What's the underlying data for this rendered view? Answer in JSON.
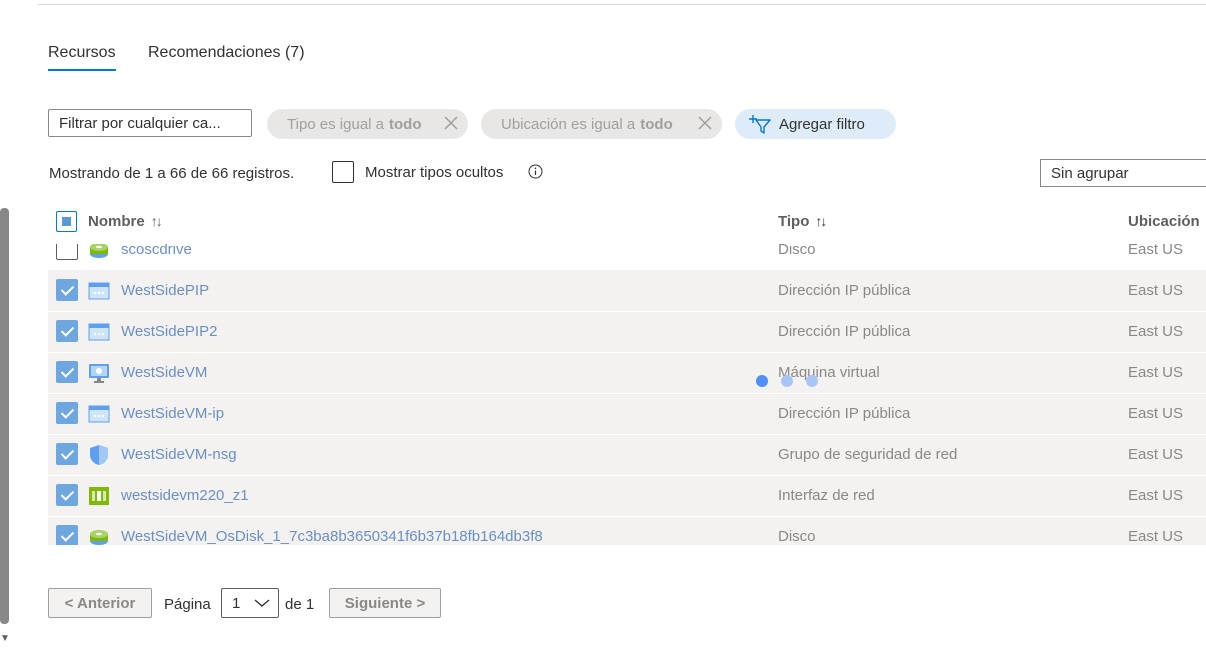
{
  "tabs": [
    {
      "label": "Recursos",
      "active": true
    },
    {
      "label": "Recomendaciones (7)",
      "active": false
    }
  ],
  "filters": {
    "search_placeholder": "Filtrar por cualquier ca...",
    "type_pill_prefix": "Tipo es igual a",
    "type_pill_value": "todo",
    "location_pill_prefix": "Ubicación es igual a",
    "location_pill_value": "todo",
    "add_filter_label": "Agregar filtro"
  },
  "summary": {
    "showing_text": "Mostrando de 1 a 66 de 66 registros.",
    "show_hidden_label": "Mostrar tipos ocultos",
    "group_by_value": "Sin agrupar"
  },
  "table": {
    "columns": [
      {
        "label": "Nombre",
        "sort": "↑↓"
      },
      {
        "label": "Tipo",
        "sort": "↑↓"
      },
      {
        "label": "Ubicación"
      }
    ],
    "rows": [
      {
        "name": "scoscdrive",
        "type": "Disco",
        "location": "East US",
        "selected": false,
        "icon": "disk-icon"
      },
      {
        "name": "WestSidePIP",
        "type": "Dirección IP pública",
        "location": "East US",
        "selected": true,
        "icon": "public-ip-icon"
      },
      {
        "name": "WestSidePIP2",
        "type": "Dirección IP pública",
        "location": "East US",
        "selected": true,
        "icon": "public-ip-icon"
      },
      {
        "name": "WestSideVM",
        "type": "Máquina virtual",
        "location": "East US",
        "selected": true,
        "icon": "virtual-machine-icon"
      },
      {
        "name": "WestSideVM-ip",
        "type": "Dirección IP pública",
        "location": "East US",
        "selected": true,
        "icon": "public-ip-icon"
      },
      {
        "name": "WestSideVM-nsg",
        "type": "Grupo de seguridad de red",
        "location": "East US",
        "selected": true,
        "icon": "network-security-group-icon"
      },
      {
        "name": "westsidevm220_z1",
        "type": "Interfaz de red",
        "location": "East US",
        "selected": true,
        "icon": "network-interface-icon"
      },
      {
        "name": "WestSideVM_OsDisk_1_7c3ba8b3650341f6b37b18fb164db3f8",
        "type": "Disco",
        "location": "East US",
        "selected": true,
        "icon": "disk-icon"
      }
    ]
  },
  "pagination": {
    "prev_label": "< Anterior",
    "page_label": "Página",
    "current_page": "1",
    "of_label": "de 1",
    "next_label": "Siguiente >"
  },
  "colors": {
    "accent": "#0078d4",
    "link": "#6a8fc4",
    "selected_row": "#f3f2f1",
    "checkbox_checked": "#6ea6df",
    "pill_bg": "#e8e7e6",
    "add_pill_bg": "#deecf9"
  }
}
